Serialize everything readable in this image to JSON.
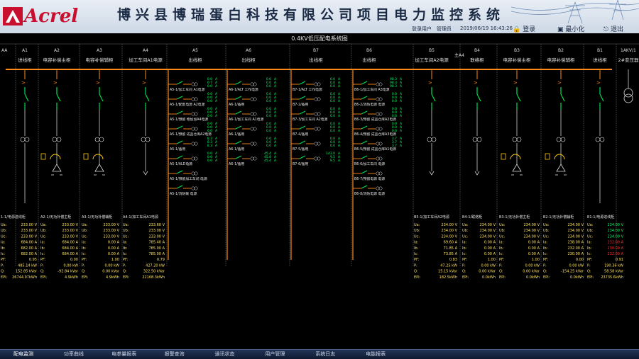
{
  "header": {
    "logo": "Acrel",
    "title": "博兴县博瑞蛋白科技有限公司项目电力监控系统",
    "user_label": "登录用户",
    "user_name": "管理员",
    "datetime": "2019/06/19  16:43:26",
    "login_label": "登录",
    "minimize_label": "最小化",
    "exit_label": "退出"
  },
  "diagram": {
    "title": "0.4KV低压配电系统图",
    "left_cut_label": "AA",
    "right_cut_label": "1AKV/1",
    "cabinets": [
      {
        "code": "A1",
        "name": "进线柜"
      },
      {
        "code": "A2",
        "name": "电容补偿主柜"
      },
      {
        "code": "A3",
        "name": "电容补偿辅柜"
      },
      {
        "code": "A4",
        "name": "加工车间A1电源"
      },
      {
        "code": "A5",
        "name": "出线柜"
      },
      {
        "code": "A6",
        "name": "出线柜"
      },
      {
        "code": "B7",
        "name": "出线柜"
      },
      {
        "code": "B6",
        "name": "出线柜"
      },
      {
        "code": "B5",
        "name": "加工车间A2电源"
      },
      {
        "code": "B4",
        "name": "联络柜"
      },
      {
        "code": "B3",
        "name": "电容补偿主柜"
      },
      {
        "code": "B2",
        "name": "电容补偿辅柜"
      },
      {
        "code": "B1",
        "name": "进线柜"
      },
      {
        "code": "",
        "name": "2#变压器"
      }
    ],
    "tie_label": "主A4",
    "feeders": {
      "A5": [
        {
          "name": "A5-1/加工车间 A1电源",
          "vals": [
            "0.0",
            "0.7",
            "0.0"
          ]
        },
        {
          "name": "A5-1/配套电源 A2电源",
          "vals": [
            "0.0",
            "0.0",
            "0.0"
          ]
        },
        {
          "name": "A5-1/预留 物加加A4电源",
          "vals": [
            "0.0",
            "0.0",
            "0.0"
          ]
        },
        {
          "name": "A5-1/预留 成品仓库A2电源",
          "vals": [
            "0.0",
            "0.0",
            "0.0"
          ]
        },
        {
          "name": "A5-1/备用",
          "vals": [
            "8.3",
            "8.3",
            "8.3"
          ]
        },
        {
          "name": "A5-1/ALD电源",
          "vals": [
            "0.0",
            "0.0",
            "0.0"
          ]
        },
        {
          "name": "A5-1/预留加工车间 电源",
          "vals": [
            "",
            "",
            " "
          ]
        },
        {
          "name": "A5-1/消防联 电源",
          "vals": [
            "",
            "",
            " "
          ]
        }
      ],
      "A6": [
        {
          "name": "A6-1/ALT 工作电源",
          "vals": [
            "0.0",
            "0.0",
            "0.0"
          ]
        },
        {
          "name": "A6-1/备用",
          "vals": [
            "0.0",
            "0.0",
            "0.0"
          ]
        },
        {
          "name": "A6-1/加工车间 A1电源",
          "vals": [
            "0.0",
            "0.0",
            "0.0"
          ]
        },
        {
          "name": "A6-1/备用",
          "vals": [
            "0.0",
            "0.0",
            "0.0"
          ]
        },
        {
          "name": "A6-1/备用",
          "vals": [
            "0.0",
            "0.0",
            "0.0"
          ]
        },
        {
          "name": "A6-1/备用",
          "vals": [
            "45.4",
            "45.8",
            "45.4"
          ]
        }
      ],
      "B7": [
        {
          "name": "B7-1/ALT 工作电源",
          "vals": [
            "0.0",
            "0.0",
            "0.0"
          ]
        },
        {
          "name": "B7-2/备用",
          "vals": [
            "0.0",
            "0.0",
            "0.0"
          ]
        },
        {
          "name": "B7-3/加工车间 A2电源",
          "vals": [
            "0.0",
            "0.0",
            "0.0"
          ]
        },
        {
          "name": "B7-4/备用",
          "vals": [
            "0.0",
            "0.0",
            "0.0"
          ]
        },
        {
          "name": "B7-5/备用",
          "vals": [
            "0.0",
            "0.0",
            "0.0"
          ]
        },
        {
          "name": "B7-6/备用",
          "vals": [
            "143.0",
            "9.5",
            "9.5"
          ]
        }
      ],
      "B6": [
        {
          "name": "B6-1/加工车间 A3电源",
          "vals": [
            "98.3",
            "98.3",
            "98.3"
          ]
        },
        {
          "name": "B6-2/消防电源 电源",
          "vals": [
            "0.0",
            "0.0",
            "0.0"
          ]
        },
        {
          "name": "B6-3/预留 成品仓库A2电源",
          "vals": [
            "0.0",
            "0.0",
            "0.0"
          ]
        },
        {
          "name": "B6-4/预留 成品仓库A3电源",
          "vals": [
            "0.0",
            "0.0",
            "0.0"
          ]
        },
        {
          "name": "B6-5/预留 成品仓库A1电源",
          "vals": [
            "3.7",
            "3.7",
            "3.7"
          ]
        },
        {
          "name": "B6-6/加工车间 电源",
          "vals": [
            "",
            "",
            " "
          ]
        },
        {
          "name": "B6-7/预留电源 电源",
          "vals": [
            "",
            "",
            " "
          ]
        },
        {
          "name": "B6-8/消防电源 电源",
          "vals": [
            "",
            "",
            " "
          ]
        }
      ]
    },
    "meters": [
      {
        "title": "1-1/电源进线柜",
        "rows": [
          [
            "Ua:",
            "233.00 V"
          ],
          [
            "Ub:",
            "233.00 V"
          ],
          [
            "Uc:",
            "233.00 V"
          ],
          [
            "Ia:",
            "684.00 A"
          ],
          [
            "Ib:",
            "682.00 A"
          ],
          [
            "Ic:",
            "682.00 A"
          ],
          [
            "PF:",
            "0.95"
          ],
          [
            "P:",
            "485.14 kW"
          ],
          [
            "Q:",
            "152.85 kVar"
          ],
          [
            "EPI:",
            "26744.97kWh"
          ]
        ]
      },
      {
        "title": "A2-1/无功补偿主柜",
        "rows": [
          [
            "Ua:",
            "233.00 V"
          ],
          [
            "Ub:",
            "233.00 V"
          ],
          [
            "Uc:",
            "233.00 V"
          ],
          [
            "Ia:",
            "684.00 A"
          ],
          [
            "Ib:",
            "684.00 A"
          ],
          [
            "Ic:",
            "684.00 A"
          ],
          [
            "PF:",
            "0.00"
          ],
          [
            "P:",
            "0.00 kW"
          ],
          [
            "Q:",
            "-92.84 kVar"
          ],
          [
            "EPI:",
            "4.9kWh"
          ]
        ]
      },
      {
        "title": "A3-1/无功补偿辅柜",
        "rows": [
          [
            "Ua:",
            "233.00 V"
          ],
          [
            "Ub:",
            "233.00 V"
          ],
          [
            "Uc:",
            "233.00 V"
          ],
          [
            "Ia:",
            "0.00 A"
          ],
          [
            "Ib:",
            "0.00 A"
          ],
          [
            "Ic:",
            "0.00 A"
          ],
          [
            "PF:",
            "1.00"
          ],
          [
            "P:",
            "0.00 kW"
          ],
          [
            "Q:",
            "0.00 kVar"
          ],
          [
            "EPI:",
            "4.9kWh"
          ]
        ]
      },
      {
        "title": "A4-1/加工车间A1电源",
        "rows": [
          [
            "Ua:",
            "233.60 V"
          ],
          [
            "Ub:",
            "233.00 V"
          ],
          [
            "Uc:",
            "233.00 V"
          ],
          [
            "Ia:",
            "785.40 A"
          ],
          [
            "Ib:",
            "785.00 A"
          ],
          [
            "Ic:",
            "785.00 A"
          ],
          [
            "PF:",
            "0.79"
          ],
          [
            "P:",
            "427.20 kW"
          ],
          [
            "Q:",
            "322.50 kVar"
          ],
          [
            "EPI:",
            "22108.3kWh"
          ]
        ]
      },
      {
        "title": "B5-1/加工车间A2电源",
        "rows": [
          [
            "Ua:",
            "234.00 V"
          ],
          [
            "Ub:",
            "234.00 V"
          ],
          [
            "Uc:",
            "234.00 V"
          ],
          [
            "Ia:",
            "69.60 A"
          ],
          [
            "Ib:",
            "71.85 A"
          ],
          [
            "Ic:",
            "73.85 A"
          ],
          [
            "PF:",
            "0.83"
          ],
          [
            "P:",
            "47.25 kW"
          ],
          [
            "Q:",
            "15.15 kVar"
          ],
          [
            "EPI:",
            "182.5kWh"
          ]
        ]
      },
      {
        "title": "B4-1/联络柜",
        "rows": [
          [
            "Ua:",
            "234.00 V"
          ],
          [
            "Ub:",
            "234.00 V"
          ],
          [
            "Uc:",
            "234.00 V"
          ],
          [
            "Ia:",
            "0.00 A"
          ],
          [
            "Ib:",
            "0.00 A"
          ],
          [
            "Ic:",
            "0.00 A"
          ],
          [
            "PF:",
            "1.00"
          ],
          [
            "P:",
            "0.00 kW"
          ],
          [
            "Q:",
            "0.00 kVar"
          ],
          [
            "EPI:",
            "0.0kWh"
          ]
        ]
      },
      {
        "title": "B3-1/无功补偿主柜",
        "rows": [
          [
            "Ua:",
            "234.00 V"
          ],
          [
            "Ub:",
            "234.00 V"
          ],
          [
            "Uc:",
            "234.00 V"
          ],
          [
            "Ia:",
            "0.00 A"
          ],
          [
            "Ib:",
            "0.00 A"
          ],
          [
            "Ic:",
            "0.00 A"
          ],
          [
            "PF:",
            "1.00"
          ],
          [
            "P:",
            "0.00 kW"
          ],
          [
            "Q:",
            "0.00 kVar"
          ],
          [
            "EPI:",
            "0.0kWh"
          ]
        ]
      },
      {
        "title": "B2-1/无功补偿辅柜",
        "rows": [
          [
            "Ua:",
            "234.00 V"
          ],
          [
            "Ub:",
            "234.00 V"
          ],
          [
            "Uc:",
            "234.00 V"
          ],
          [
            "Ia:",
            "238.00 A"
          ],
          [
            "Ib:",
            "232.00 A"
          ],
          [
            "Ic:",
            "230.00 A"
          ],
          [
            "PF:",
            "0.00"
          ],
          [
            "P:",
            "0.00 kW"
          ],
          [
            "Q:",
            "-154.25 kVar"
          ],
          [
            "EPI:",
            "0.0kWh"
          ]
        ]
      },
      {
        "title": "B1-1/电源进线柜",
        "rows": [
          [
            "Ua:",
            "234.00 V"
          ],
          [
            "Ub:",
            "234.00 V"
          ],
          [
            "Uc:",
            "234.00 V"
          ],
          [
            "Ia:",
            "232.00 A"
          ],
          [
            "Ib:",
            "230.00 A"
          ],
          [
            "Ic:",
            "232.00 A"
          ],
          [
            "PF:",
            "0.91"
          ],
          [
            "P:",
            "190.36 kW"
          ],
          [
            "Q:",
            "58.58 kVar"
          ],
          [
            "EPI:",
            "23735.6kWh"
          ]
        ]
      }
    ]
  },
  "footer": {
    "tabs": [
      "配电监测",
      "功率曲线",
      "电参量报表",
      "报警查询",
      "通讯状态",
      "用户管理",
      "系统日志",
      "电能报表"
    ]
  },
  "colors": {
    "busbar": "#ff8a1a",
    "breaker": "#00e050",
    "label": "#ff8a1a",
    "meter_label": "#ffe25a",
    "meter_value": "#ffe25a",
    "ok_value": "#00ff66",
    "warn_value": "#ff3030"
  }
}
